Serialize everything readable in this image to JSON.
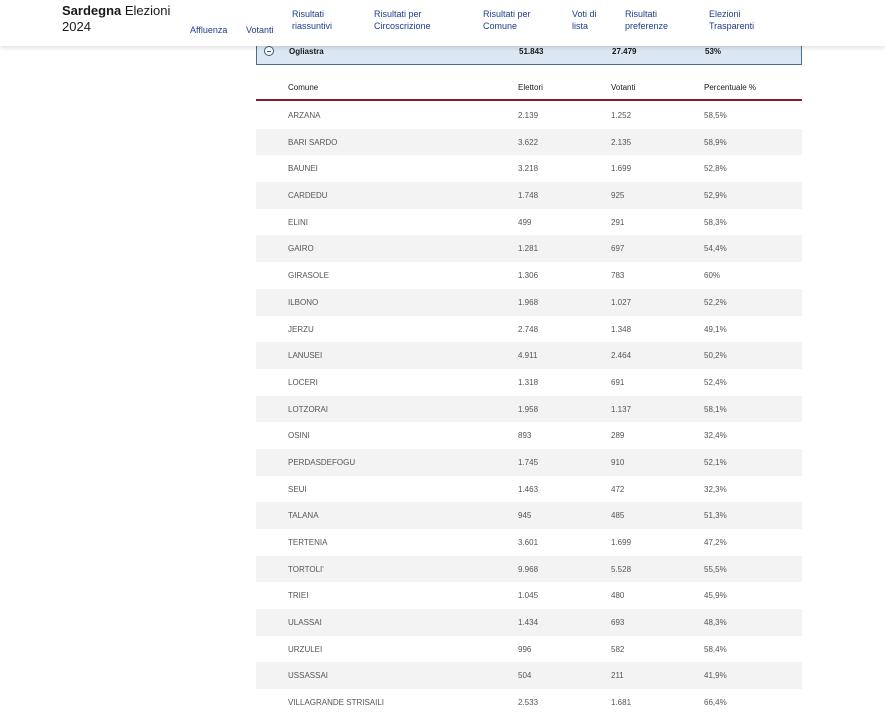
{
  "header": {
    "brand_bold": "Sardegna",
    "brand_rest": "Elezioni",
    "brand_year": "2024",
    "nav": [
      {
        "line1": "Affluenza",
        "line2": ""
      },
      {
        "line1": "Votanti",
        "line2": ""
      },
      {
        "line1": "Risultati",
        "line2": "riassuntivi"
      },
      {
        "line1": "Risultati per",
        "line2": "Circoscrizione"
      },
      {
        "line1": "Risultati per",
        "line2": "Comune"
      },
      {
        "line1": "Voti di",
        "line2": "lista"
      },
      {
        "line1": "Risultati",
        "line2": "preferenze"
      },
      {
        "line1": "Elezioni",
        "line2": "Trasparenti"
      }
    ]
  },
  "province": {
    "name": "Ogliastra",
    "elettori": "51.843",
    "votanti": "27.479",
    "percentuale": "53%"
  },
  "table": {
    "columns": [
      "Comune",
      "Elettori",
      "Votanti",
      "Percentuale %"
    ],
    "rows": [
      [
        "ARZANA",
        "2.139",
        "1.252",
        "58,5%"
      ],
      [
        "BARI SARDO",
        "3.622",
        "2.135",
        "58,9%"
      ],
      [
        "BAUNEI",
        "3.218",
        "1.699",
        "52,8%"
      ],
      [
        "CARDEDU",
        "1.748",
        "925",
        "52,9%"
      ],
      [
        "ELINI",
        "499",
        "291",
        "58,3%"
      ],
      [
        "GAIRO",
        "1.281",
        "697",
        "54,4%"
      ],
      [
        "GIRASOLE",
        "1.306",
        "783",
        "60%"
      ],
      [
        "ILBONO",
        "1.968",
        "1.027",
        "52,2%"
      ],
      [
        "JERZU",
        "2.748",
        "1.348",
        "49,1%"
      ],
      [
        "LANUSEI",
        "4.911",
        "2.464",
        "50,2%"
      ],
      [
        "LOCERI",
        "1.318",
        "691",
        "52,4%"
      ],
      [
        "LOTZORAI",
        "1.958",
        "1.137",
        "58,1%"
      ],
      [
        "OSINI",
        "893",
        "289",
        "32,4%"
      ],
      [
        "PERDASDEFOGU",
        "1.745",
        "910",
        "52,1%"
      ],
      [
        "SEUI",
        "1.463",
        "472",
        "32,3%"
      ],
      [
        "TALANA",
        "945",
        "485",
        "51,3%"
      ],
      [
        "TERTENIA",
        "3.601",
        "1.699",
        "47,2%"
      ],
      [
        "TORTOLI'",
        "9.968",
        "5.528",
        "55,5%"
      ],
      [
        "TRIEI",
        "1.045",
        "480",
        "45,9%"
      ],
      [
        "ULASSAI",
        "1.434",
        "693",
        "48,3%"
      ],
      [
        "URZULEI",
        "996",
        "582",
        "58,4%"
      ],
      [
        "USSASSAI",
        "504",
        "211",
        "41,9%"
      ],
      [
        "VILLAGRANDE STRISAILI",
        "2.533",
        "1.681",
        "66,4%"
      ]
    ]
  }
}
